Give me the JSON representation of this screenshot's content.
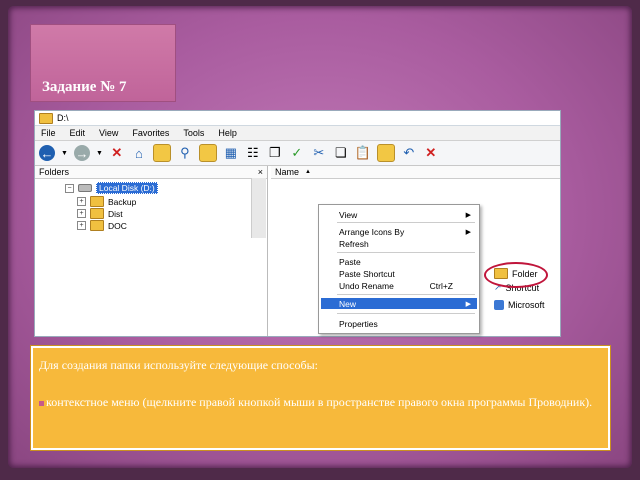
{
  "slide": {
    "title": "Задание № 7",
    "text_intro": "Для создания папки используйте следующие способы:",
    "bullet_text": "контекстное меню (щелкните правой кнопкой мыши в пространстве правого окна программы Проводник)."
  },
  "window": {
    "title": "D:\\",
    "menu": [
      "File",
      "Edit",
      "View",
      "Favorites",
      "Tools",
      "Help"
    ],
    "left_pane_header": "Folders",
    "close_glyph": "×",
    "right_pane_header": "Name",
    "tree": {
      "root": "Local Disk (D:)",
      "children": [
        "Backup",
        "Dist",
        "DOC"
      ]
    }
  },
  "context_menu": {
    "items": [
      {
        "label": "View",
        "submenu": true
      },
      {
        "label": "Arrange Icons By",
        "submenu": true
      },
      {
        "label": "Refresh",
        "submenu": false
      },
      {
        "label": "Paste",
        "submenu": false
      },
      {
        "label": "Paste Shortcut",
        "submenu": false
      },
      {
        "label": "Undo Rename",
        "shortcut": "Ctrl+Z",
        "submenu": false
      },
      {
        "label": "New",
        "submenu": true,
        "highlighted": true
      },
      {
        "label": "Properties",
        "submenu": false
      }
    ]
  },
  "new_submenu": {
    "items": [
      "Folder",
      "Shortcut",
      "Microsoft"
    ]
  },
  "colors": {
    "background": "#a95c9f",
    "title_box": "#c0649a",
    "info_box": "#f7b93b",
    "highlight": "#2b6cd4",
    "annotation_circle": "#c0153b"
  }
}
